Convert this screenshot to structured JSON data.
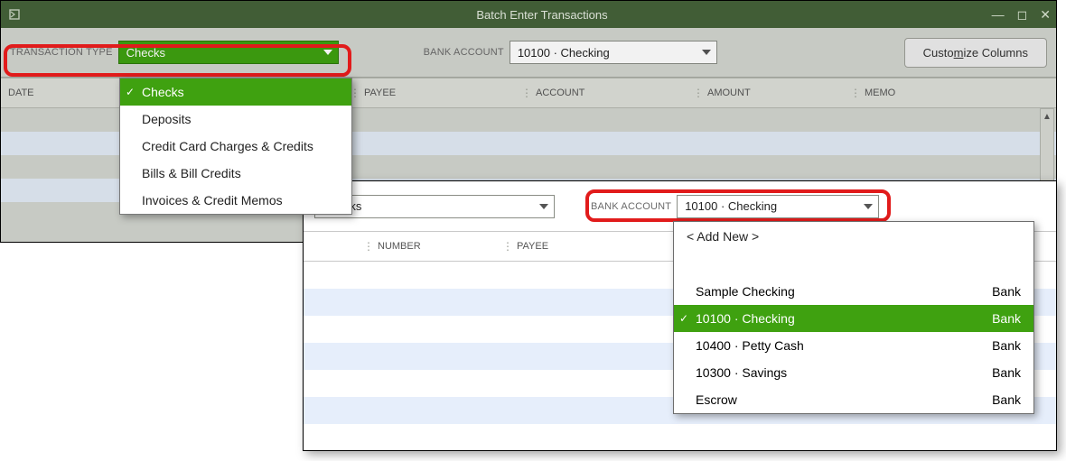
{
  "titlebar": {
    "title": "Batch Enter Transactions"
  },
  "toolbar": {
    "transaction_type_label": "TRANSACTION TYPE",
    "transaction_type_value": "Checks",
    "bank_account_label": "BANK ACCOUNT",
    "bank_account_value": "10100 · Checking",
    "customize_prefix": "Custo",
    "customize_ul": "m",
    "customize_suffix": "ize Columns"
  },
  "grid": {
    "columns": {
      "date": "DATE",
      "number": "NUMBER",
      "payee": "PAYEE",
      "account": "ACCOUNT",
      "amount": "AMOUNT",
      "memo": "MEMO"
    }
  },
  "type_menu": {
    "items": [
      "Checks",
      "Deposits",
      "Credit Card Charges & Credits",
      "Bills & Bill Credits",
      "Invoices & Credit Memos"
    ]
  },
  "win2": {
    "transaction_type_value": "Checks",
    "bank_account_label": "BANK ACCOUNT",
    "bank_account_value": "10100 · Checking",
    "columns": {
      "number": "NUMBER",
      "payee": "PAYEE"
    }
  },
  "acct_menu": {
    "addnew": "< Add New >",
    "rows": [
      {
        "name": "Sample Checking",
        "type": "Bank"
      },
      {
        "name": "10100 · Checking",
        "type": "Bank"
      },
      {
        "name": "10400 · Petty Cash",
        "type": "Bank"
      },
      {
        "name": "10300 · Savings",
        "type": "Bank"
      },
      {
        "name": "Escrow",
        "type": "Bank"
      }
    ]
  }
}
